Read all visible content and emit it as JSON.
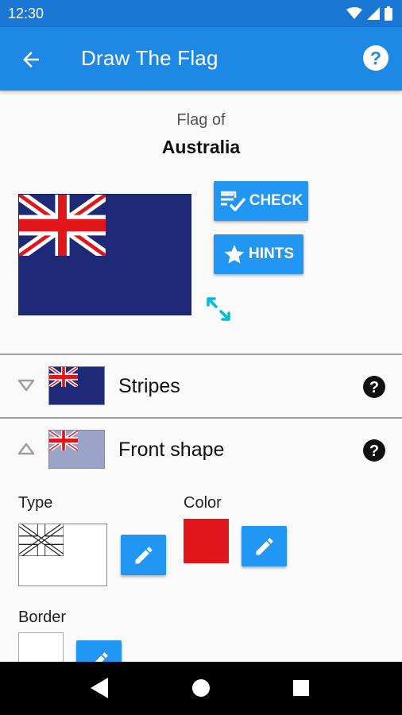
{
  "status_bar": {
    "time": "12:30",
    "icons": [
      "wifi-icon",
      "signal-icon",
      "battery-icon"
    ]
  },
  "app_bar": {
    "title": "Draw The Flag",
    "back_icon": "arrow-back-icon",
    "help_icon": "help-circle-icon"
  },
  "header": {
    "flag_of": "Flag of",
    "country": "Australia"
  },
  "actions": {
    "check_label": "CHECK",
    "check_icon": "rule-check-icon",
    "hints_label": "HINTS",
    "hints_icon": "star-icon",
    "expand_icon": "expand-diagonal-icon"
  },
  "sections": [
    {
      "label": "Stripes",
      "expanded": false,
      "thumb_color": "#1e2a78"
    },
    {
      "label": "Front shape",
      "expanded": true,
      "thumb_color": "#9aa4c8"
    }
  ],
  "front_shape": {
    "type_label": "Type",
    "color_label": "Color",
    "border_label": "Border",
    "color_value": "#e0161b",
    "border_value": "#ffffff"
  },
  "colors": {
    "primary_dark": "#1976d2",
    "primary": "#1e88e5",
    "button": "#2196f3",
    "flag_blue": "#1e2a78",
    "flag_red": "#e0161b",
    "accent_cyan": "#00bcd4"
  }
}
